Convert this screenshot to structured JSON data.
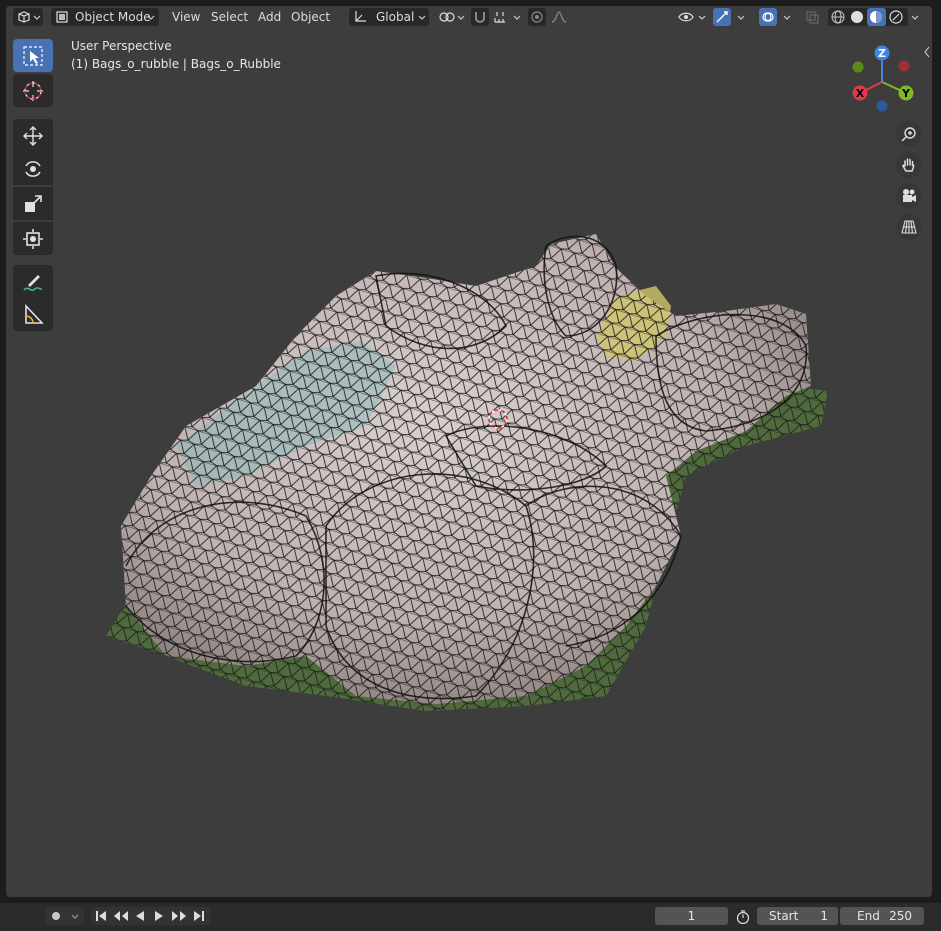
{
  "header": {
    "editor_type_icon": "3d-viewport-icon",
    "mode": "Object Mode",
    "menus": [
      "View",
      "Select",
      "Add",
      "Object"
    ],
    "orientation": "Global"
  },
  "overlay": {
    "line1": "User Perspective",
    "line2": "(1) Bags_o_rubble | Bags_o_Rubble"
  },
  "gizmo": {
    "z": "Z",
    "y": "Y",
    "x": "X"
  },
  "toolbar": {
    "tools": [
      "select-box-icon",
      "cursor-icon",
      "move-icon",
      "rotate-icon",
      "scale-icon",
      "transform-icon",
      "annotate-icon",
      "measure-icon"
    ],
    "active": "select-box-icon"
  },
  "timeline": {
    "current_frame": "1",
    "start_label": "Start",
    "start_value": "1",
    "end_label": "End",
    "end_value": "250"
  },
  "colors": {
    "viewport_bg": "#3d3d3d",
    "active_tool": "#4772b3",
    "axis_x": "#e3384a",
    "axis_y": "#7dba23",
    "axis_z": "#3f84e2"
  }
}
